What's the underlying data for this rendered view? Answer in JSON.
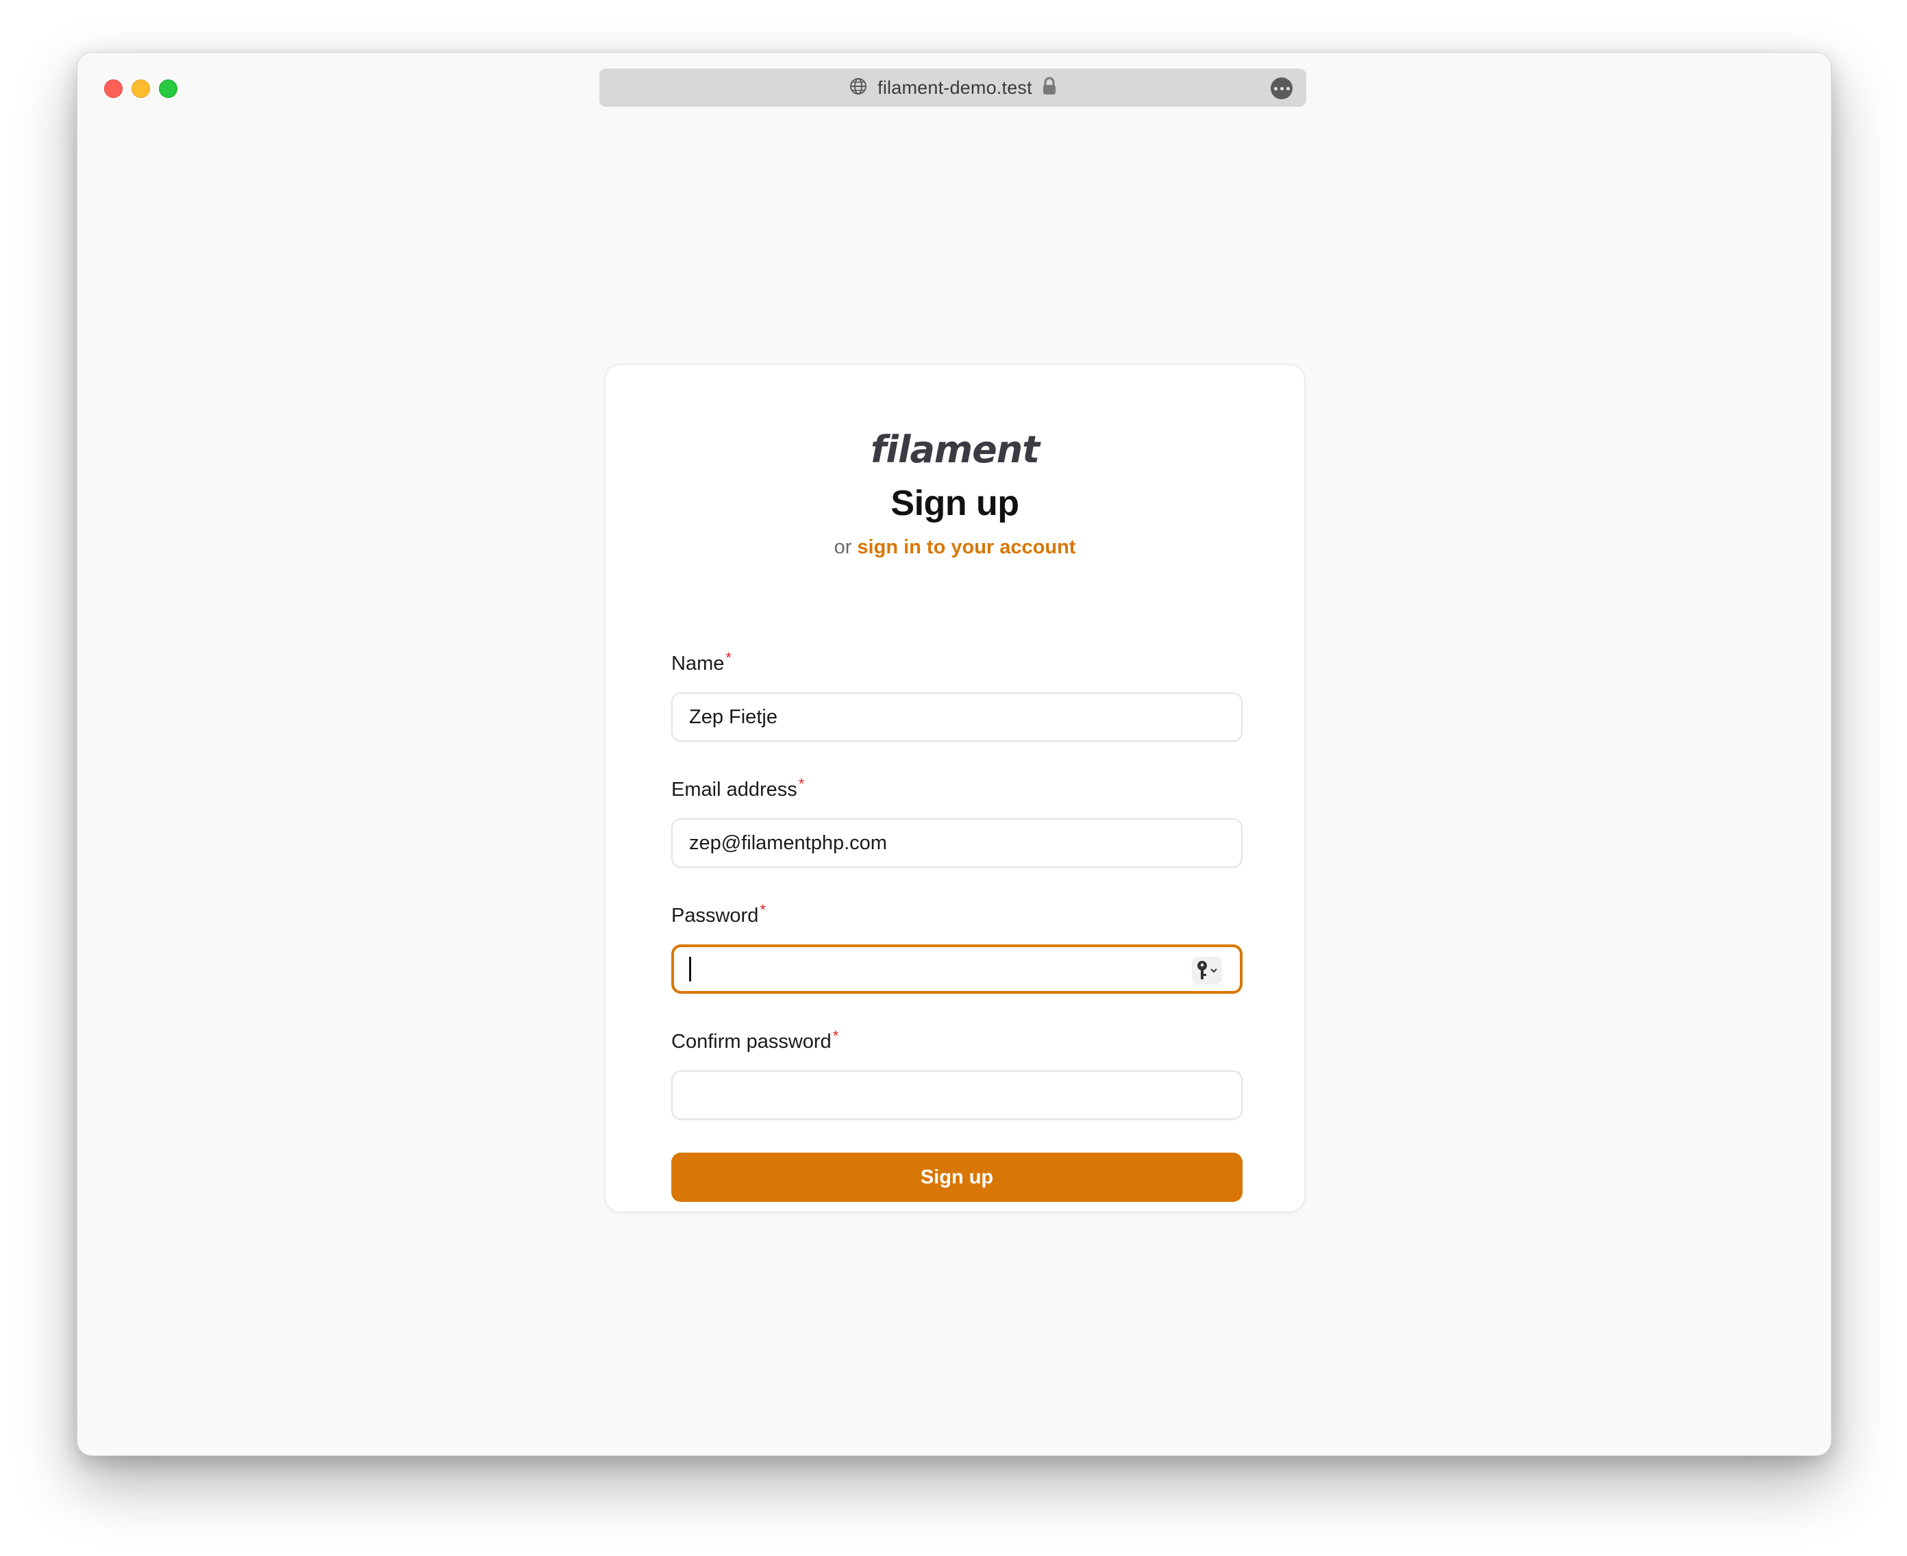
{
  "browser": {
    "url": "filament-demo.test"
  },
  "brand": {
    "logo_text": "filament",
    "accent": "#d97706",
    "required_color": "#dc2626"
  },
  "form": {
    "heading": "Sign up",
    "sub_prefix": "or",
    "sub_link": "sign in to your account",
    "required_mark": "*",
    "fields": [
      {
        "label": "Name",
        "value": "Zep Fietje"
      },
      {
        "label": "Email address",
        "value": "zep@filamentphp.com"
      },
      {
        "label": "Password",
        "value": ""
      },
      {
        "label": "Confirm password",
        "value": ""
      }
    ],
    "submit_label": "Sign up"
  }
}
